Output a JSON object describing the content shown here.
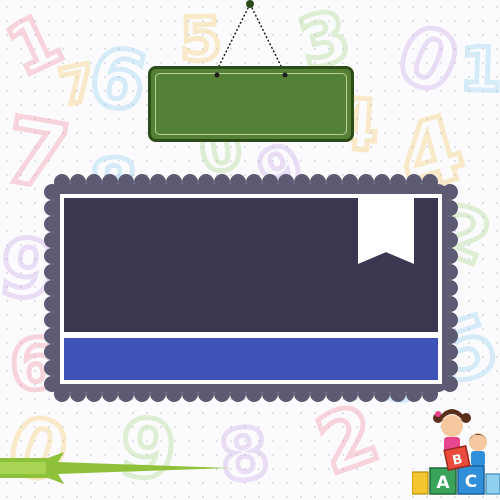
{
  "scene": {
    "background_digits": [
      "1",
      "6",
      "5",
      "3",
      "0",
      "7",
      "8",
      "4",
      "2",
      "9",
      "6",
      "5",
      "0",
      "9",
      "8",
      "2",
      "3",
      "4",
      "0",
      "9",
      "6",
      "1",
      "7"
    ],
    "digit_colors": [
      "#f08aa0",
      "#8fd0f0",
      "#f3c86a",
      "#a8d88a",
      "#c9a6e8"
    ]
  },
  "sign_board": {
    "color": "#548135",
    "text": ""
  },
  "question_panel": {
    "frame_color": "#5d5b73",
    "screen_color": "#393850",
    "answer_bar_color": "#3e53b8",
    "question_text": "",
    "answer_text": ""
  },
  "decor": {
    "mascot_blocks": [
      "A",
      "C",
      "B"
    ],
    "arrow_color": "#8fc13a"
  }
}
